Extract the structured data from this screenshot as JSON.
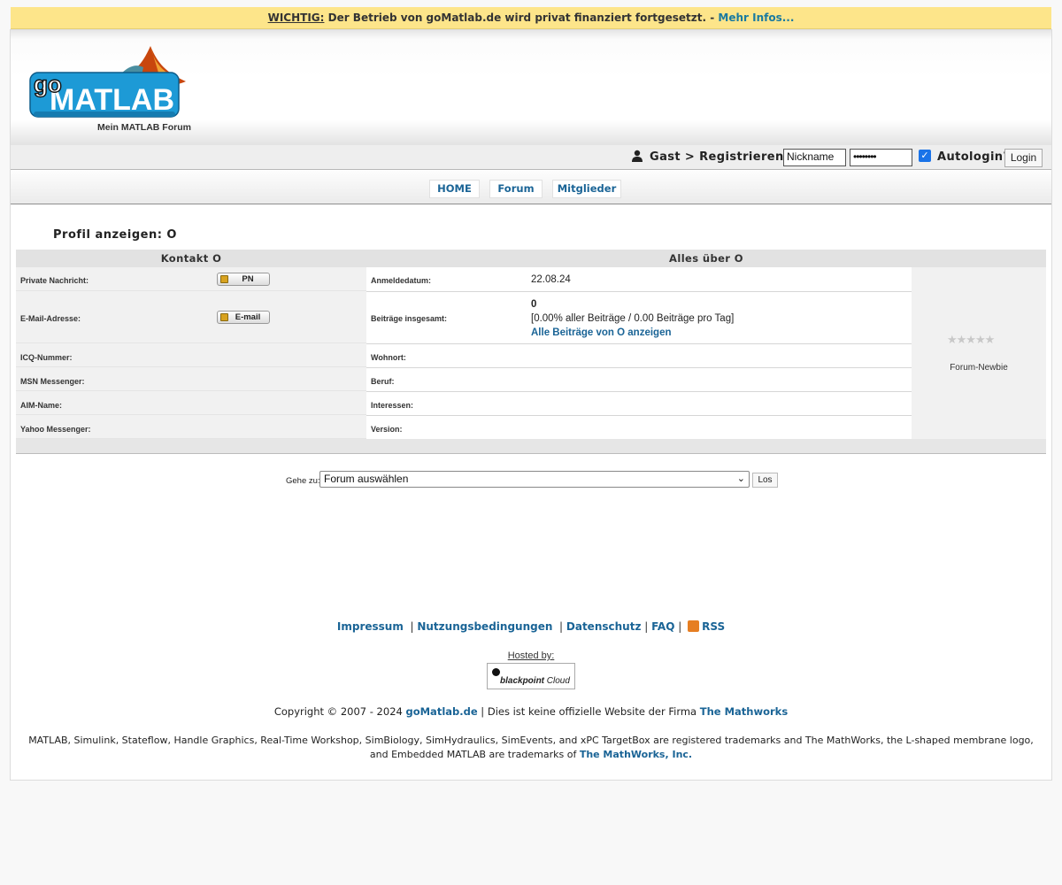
{
  "notice": {
    "important": "WICHTIG:",
    "text": " Der Betrieb von goMatlab.de wird privat finanziert fortgesetzt. - ",
    "link": "Mehr Infos..."
  },
  "header": {
    "logo_text": "MATLAB",
    "logo_prefix": "go",
    "tagline": "Mein MATLAB Forum"
  },
  "loginbar": {
    "guest_text": "Gast > Registrieren",
    "nickname_value": "Nickname",
    "password_value": "••••••••",
    "autologin_label": "Autologin?",
    "login_button": "Login"
  },
  "nav": {
    "tabs": [
      {
        "label": "HOME"
      },
      {
        "label": "Forum"
      },
      {
        "label": "Mitglieder"
      }
    ]
  },
  "profile": {
    "title": "Profil anzeigen: O",
    "left_header": "Kontakt O",
    "right_header": "Alles über O",
    "contact_rows": [
      {
        "label": "Private Nachricht:"
      },
      {
        "label": "E-Mail-Adresse:"
      },
      {
        "label": "ICQ-Nummer:"
      },
      {
        "label": "MSN Messenger:"
      },
      {
        "label": "AIM-Name:"
      },
      {
        "label": "Yahoo Messenger:"
      }
    ],
    "pm_button": "PN",
    "email_button": "E-mail",
    "about_rows": [
      {
        "label": "Anmeldedatum:",
        "value": "22.08.24"
      },
      {
        "label": "Beiträge insgesamt:",
        "value": "0"
      },
      {
        "label": "Wohnort:",
        "value": ""
      },
      {
        "label": "Beruf:",
        "value": ""
      },
      {
        "label": "Interessen:",
        "value": ""
      },
      {
        "label": "Version:",
        "value": ""
      }
    ],
    "posts_stats": "[0.00% aller Beiträge / 0.00 Beiträge pro Tag]",
    "posts_link": "Alle Beiträge von O anzeigen",
    "rank": "Forum-Newbie",
    "stars": "★★★★★",
    "rank_level": 0
  },
  "jump": {
    "label": "Gehe zu:",
    "selected": "Forum auswählen",
    "button": "Los"
  },
  "footer": {
    "links": [
      "Impressum",
      "Nutzungsbedingungen",
      "Datenschutz",
      "FAQ",
      "RSS"
    ],
    "hosted_by": "Hosted by:",
    "host_name": "blackpoint",
    "host_suffix": "Cloud",
    "copyright_prefix": "Copyright © 2007 - 2024 ",
    "copyright_site": "goMatlab.de",
    "copyright_mid": " | Dies ist keine offizielle Website der Firma ",
    "copyright_company": "The Mathworks",
    "trademark_text": "MATLAB, Simulink, Stateflow, Handle Graphics, Real-Time Workshop, SimBiology, SimHydraulics, SimEvents, and xPC TargetBox are registered trademarks and The MathWorks, the L-shaped membrane logo, and Embedded MATLAB are trademarks of ",
    "trademark_link": "The MathWorks, Inc."
  },
  "colors": {
    "link": "#1a6496",
    "notice_bg": "#fde58a",
    "logo_blue": "#1d9ad6"
  }
}
